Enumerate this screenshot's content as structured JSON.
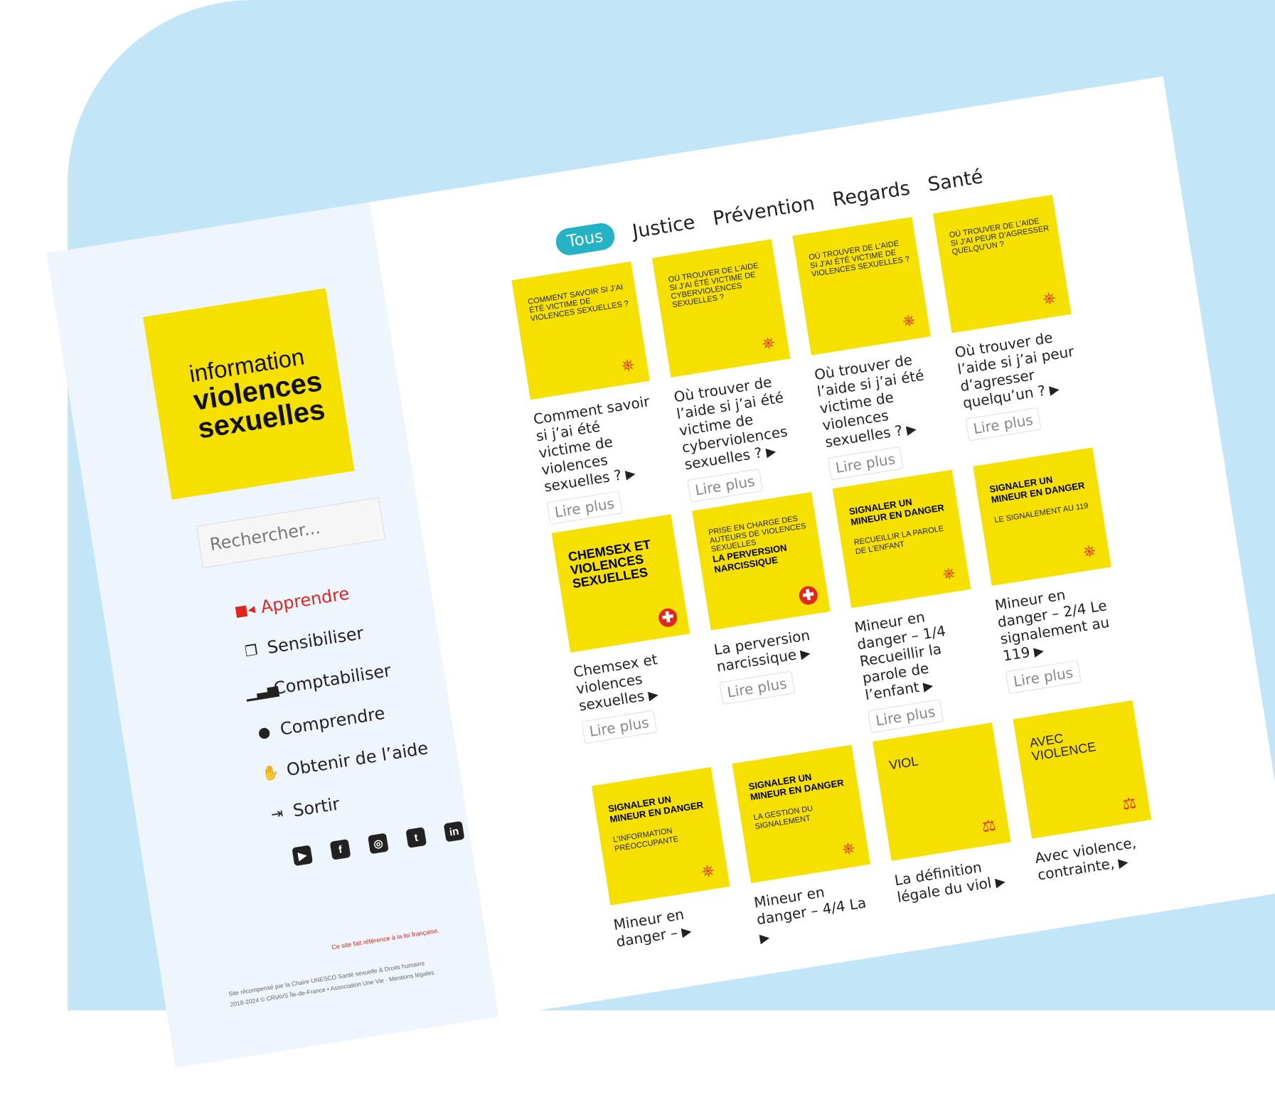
{
  "logo": {
    "line1": "information",
    "line2": "violences",
    "line3": "sexuelles"
  },
  "search": {
    "placeholder": "Rechercher..."
  },
  "nav": [
    {
      "icon": "video-camera-icon",
      "glyph": "■◂",
      "label": "Apprendre",
      "active": true
    },
    {
      "icon": "documents-icon",
      "glyph": "❐",
      "label": "Sensibiliser",
      "active": false
    },
    {
      "icon": "bar-chart-icon",
      "glyph": "▁▃▅",
      "label": "Comptabiliser",
      "active": false
    },
    {
      "icon": "brain-icon",
      "glyph": "●",
      "label": "Comprendre",
      "active": false
    },
    {
      "icon": "handshake-icon",
      "glyph": "✋",
      "label": "Obtenir de l’aide",
      "active": false
    },
    {
      "icon": "sign-out-icon",
      "glyph": "⇥",
      "label": "Sortir",
      "active": false
    }
  ],
  "social": [
    {
      "name": "youtube-icon",
      "glyph": "▶"
    },
    {
      "name": "facebook-icon",
      "glyph": "f"
    },
    {
      "name": "instagram-icon",
      "glyph": "◎"
    },
    {
      "name": "twitter-icon",
      "glyph": "t"
    },
    {
      "name": "linkedin-icon",
      "glyph": "in"
    }
  ],
  "notice": "Ce site fait référence à la loi française.",
  "footer": {
    "line1": "Site récompensé par la Chaire UNESCO Santé sexuelle & Droits humains",
    "line2": "2018-2024 © CRIAVS Île-de-France • Association Une Vie · Mentions légales"
  },
  "tabs": [
    "Tous",
    "Justice",
    "Prévention",
    "Regards",
    "Santé"
  ],
  "cards": [
    {
      "thumb": "COMMENT SAVOIR SI J’AI ÉTÉ VICTIME DE VIOLENCES SEXUELLES ?",
      "thumb_bold": "",
      "thumb_sub": "",
      "badge": "wheel",
      "title": "Comment savoir si j’ai été victime de violences sexuelles ?",
      "more": "Lire plus"
    },
    {
      "thumb": "OÙ TROUVER DE L’AIDE SI J’AI ÉTÉ VICTIME DE CYBERVIOLENCES SEXUELLES ?",
      "thumb_bold": "",
      "thumb_sub": "",
      "badge": "wheel",
      "title": "Où trouver de l’aide si j’ai été victime de cyberviolences sexuelles ?",
      "more": "Lire plus"
    },
    {
      "thumb": "OÙ TROUVER DE L’AIDE SI J’AI ÉTÉ VICTIME DE VIOLENCES SEXUELLES ?",
      "thumb_bold": "",
      "thumb_sub": "",
      "badge": "wheel",
      "title": "Où trouver de l’aide si j’ai été victime de violences sexuelles ?",
      "more": "Lire plus"
    },
    {
      "thumb": "OÙ TROUVER DE L’AIDE SI J’AI PEUR D’AGRESSER QUELQU’UN ?",
      "thumb_bold": "",
      "thumb_sub": "",
      "badge": "wheel",
      "title": "Où trouver de l’aide si j’ai peur d’agresser quelqu’un ?",
      "more": "Lire plus"
    },
    {
      "thumb": "",
      "thumb_bold": "CHEMSEX ET VIOLENCES SEXUELLES",
      "thumb_sub": "",
      "badge": "cross",
      "title": "Chemsex et violences sexuelles",
      "more": "Lire plus"
    },
    {
      "thumb": "PRISE EN CHARGE DES AUTEURS DE VIOLENCES SEXUELLES",
      "thumb_bold": "LA PERVERSION NARCISSIQUE",
      "thumb_sub": "",
      "badge": "cross",
      "title": "La perversion narcissique",
      "more": "Lire plus"
    },
    {
      "thumb": "",
      "thumb_bold": "SIGNALER UN MINEUR EN DANGER",
      "thumb_sub": "RECUEILLIR LA PAROLE DE L’ENFANT",
      "badge": "wheel",
      "title": "Mineur en danger – 1/4 Recueillir la parole de l’enfant",
      "more": "Lire plus"
    },
    {
      "thumb": "",
      "thumb_bold": "SIGNALER UN MINEUR EN DANGER",
      "thumb_sub": "LE SIGNALEMENT AU 119",
      "badge": "wheel",
      "title": "Mineur en danger – 2/4 Le signalement au 119",
      "more": "Lire plus"
    },
    {
      "thumb": "",
      "thumb_bold": "SIGNALER UN MINEUR EN DANGER",
      "thumb_sub": "L’INFORMATION PRÉOCCUPANTE",
      "badge": "wheel",
      "title": "Mineur en danger –",
      "more": ""
    },
    {
      "thumb": "",
      "thumb_bold": "SIGNALER UN MINEUR EN DANGER",
      "thumb_sub": "LA GESTION DU SIGNALEMENT",
      "badge": "wheel",
      "title": "Mineur en danger – 4/4 La",
      "more": ""
    },
    {
      "thumb": "VIOL",
      "thumb_bold": "",
      "thumb_sub": "",
      "badge": "scales",
      "title": "La définition légale du viol",
      "more": ""
    },
    {
      "thumb": "AVEC VIOLENCE",
      "thumb_bold": "",
      "thumb_sub": "",
      "badge": "scales",
      "title": "Avec violence, contrainte,",
      "more": ""
    }
  ],
  "colors": {
    "yellow": "#f6e000",
    "accent_red": "#e2261d",
    "tab_teal": "#23b2c6",
    "background": "#c2e6f8"
  }
}
